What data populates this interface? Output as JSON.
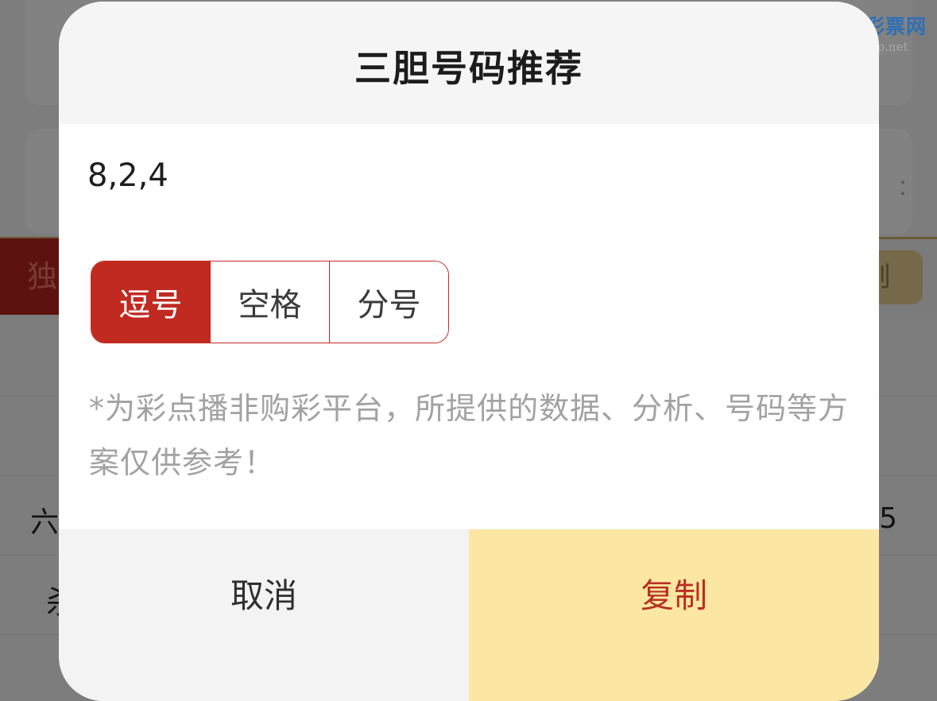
{
  "background": {
    "left_tab_label": "独",
    "right_button_label": "则",
    "row_left_1": "六",
    "row_left_2": "杀",
    "row_right_1": "5",
    "card_right_text": "：",
    "watermark": {
      "title": "特区彩票网",
      "url": "www.tqcp.net"
    }
  },
  "modal": {
    "title": "三胆号码推荐",
    "numbers": "8,2,4",
    "separators": [
      {
        "label": "逗号",
        "active": true
      },
      {
        "label": "空格",
        "active": false
      },
      {
        "label": "分号",
        "active": false
      }
    ],
    "disclaimer": "*为彩点播非购彩平台，所提供的数据、分析、号码等方案仅供参考！",
    "cancel_label": "取消",
    "copy_label": "复制"
  },
  "colors": {
    "accent_red": "#c02a21",
    "copy_bg": "#fbe7a3"
  }
}
